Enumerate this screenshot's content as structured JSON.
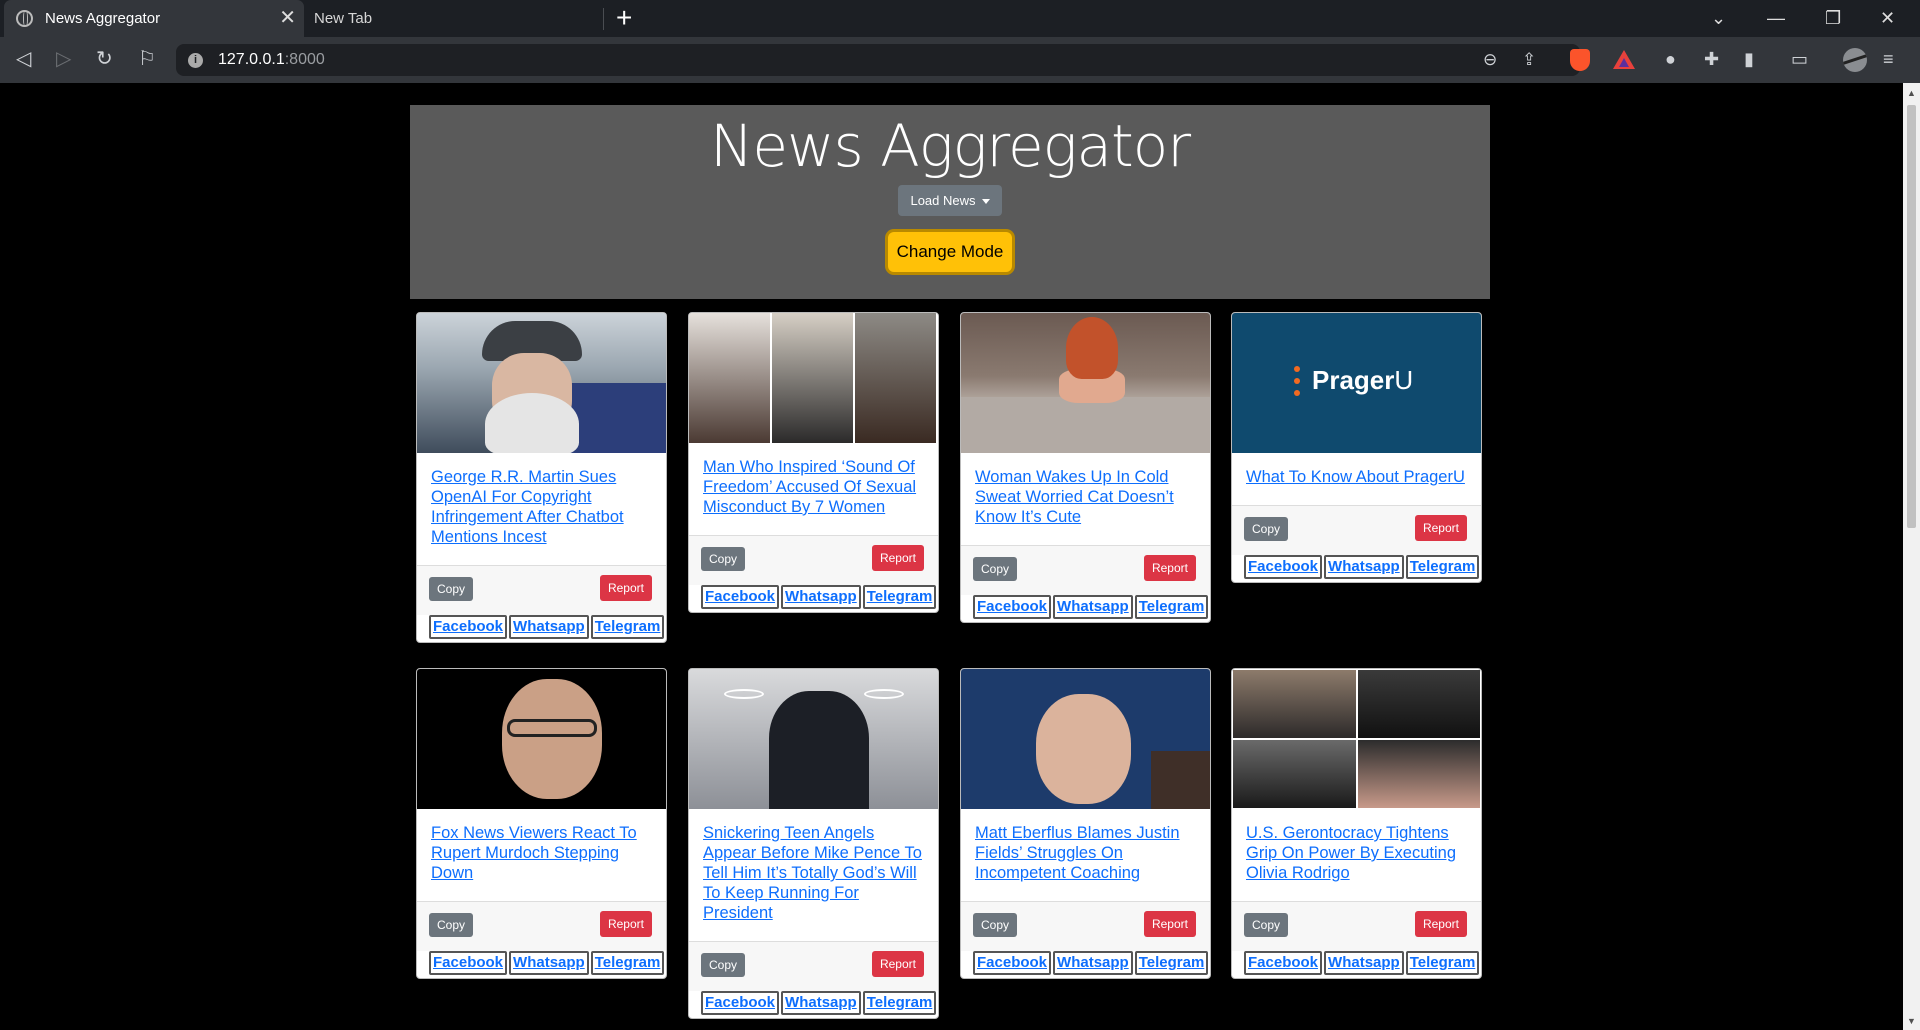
{
  "browser": {
    "active_tab_title": "News Aggregator",
    "inactive_tab_title": "New Tab",
    "url_host": "127.0.0.1",
    "url_port": ":8000"
  },
  "page": {
    "title": "News Aggregator",
    "load_news_label": "Load News",
    "change_mode_label": "Change Mode"
  },
  "card_labels": {
    "copy": "Copy",
    "report": "Report",
    "facebook": "Facebook",
    "whatsapp": "Whatsapp",
    "telegram": "Telegram"
  },
  "articles": [
    {
      "title": "George R.R. Martin Sues OpenAI For Copyright Infringement After Chatbot Mentions Incest"
    },
    {
      "title": "Man Who Inspired ‘Sound Of Freedom’ Accused Of Sexual Misconduct By 7 Women"
    },
    {
      "title": "Woman Wakes Up In Cold Sweat Worried Cat Doesn’t Know It’s Cute"
    },
    {
      "title": "What To Know About PragerU"
    },
    {
      "title": "Fox News Viewers React To Rupert Murdoch Stepping Down"
    },
    {
      "title": "Snickering Teen Angels Appear Before Mike Pence To Tell Him It’s Totally God’s Will To Keep Running For President"
    },
    {
      "title": "Matt Eberflus Blames Justin Fields’ Struggles On Incompetent Coaching"
    },
    {
      "title": "U.S. Gerontocracy Tightens Grip On Power By Executing Olivia Rodrigo"
    }
  ],
  "logos": {
    "prageru_text": "Prager",
    "prageru_u": "U"
  },
  "colors": {
    "warning_yellow": "#ffc107",
    "danger_red": "#dc3545",
    "secondary_gray": "#6c757d",
    "link_blue": "#0d6efd"
  }
}
